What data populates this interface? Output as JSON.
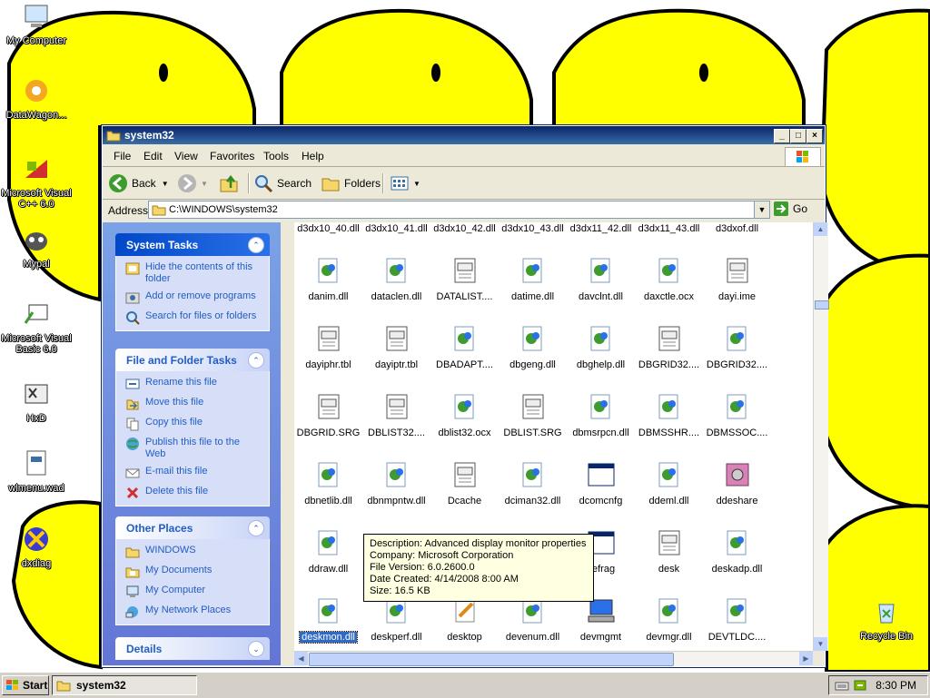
{
  "desktop": {
    "icons": [
      {
        "label": "My Computer",
        "icon": "my-computer-icon"
      },
      {
        "label": "DataWagon...",
        "icon": "datawagon-icon"
      },
      {
        "label": "Microsoft Visual C++ 6.0",
        "icon": "visual-cpp-icon"
      },
      {
        "label": "Mypal",
        "icon": "mypal-icon"
      },
      {
        "label": "Microsoft Visual Basic 6.0",
        "icon": "visual-basic-icon"
      },
      {
        "label": "HxD",
        "icon": "hxd-icon"
      },
      {
        "label": "wlmenu.wad",
        "icon": "wad-file-icon"
      },
      {
        "label": "dxdiag",
        "icon": "dxdiag-icon"
      },
      {
        "label": "Recycle Bin",
        "icon": "recycle-bin-icon"
      }
    ]
  },
  "window": {
    "title": "system32",
    "menu": [
      "File",
      "Edit",
      "View",
      "Favorites",
      "Tools",
      "Help"
    ],
    "toolbar": {
      "back": "Back",
      "search": "Search",
      "folders": "Folders"
    },
    "address": {
      "label": "Address",
      "path": "C:\\WINDOWS\\system32",
      "go": "Go"
    }
  },
  "taskpane": {
    "system_tasks": {
      "title": "System Tasks",
      "items": [
        "Hide the contents of this folder",
        "Add or remove programs",
        "Search for files or folders"
      ]
    },
    "file_tasks": {
      "title": "File and Folder Tasks",
      "items": [
        "Rename this file",
        "Move this file",
        "Copy this file",
        "Publish this file to the Web",
        "E-mail this file",
        "Delete this file"
      ]
    },
    "other_places": {
      "title": "Other Places",
      "items": [
        "WINDOWS",
        "My Documents",
        "My Computer",
        "My Network Places"
      ]
    },
    "details": {
      "title": "Details"
    }
  },
  "files": {
    "rows": [
      [
        {
          "name": "d3dx10_40.dll",
          "type": "dll"
        },
        {
          "name": "d3dx10_41.dll",
          "type": "dll"
        },
        {
          "name": "d3dx10_42.dll",
          "type": "dll"
        },
        {
          "name": "d3dx10_43.dll",
          "type": "dll"
        },
        {
          "name": "d3dx11_42.dll",
          "type": "dll"
        },
        {
          "name": "d3dx11_43.dll",
          "type": "dll"
        },
        {
          "name": "d3dxof.dll",
          "type": "dll"
        }
      ],
      [
        {
          "name": "danim.dll",
          "type": "dll"
        },
        {
          "name": "dataclen.dll",
          "type": "dll"
        },
        {
          "name": "DATALIST....",
          "type": "doc"
        },
        {
          "name": "datime.dll",
          "type": "dll"
        },
        {
          "name": "davclnt.dll",
          "type": "dll"
        },
        {
          "name": "daxctle.ocx",
          "type": "dll"
        },
        {
          "name": "dayi.ime",
          "type": "doc"
        }
      ],
      [
        {
          "name": "dayiphr.tbl",
          "type": "doc"
        },
        {
          "name": "dayiptr.tbl",
          "type": "doc"
        },
        {
          "name": "DBADAPT....",
          "type": "dll"
        },
        {
          "name": "dbgeng.dll",
          "type": "dll"
        },
        {
          "name": "dbghelp.dll",
          "type": "dll"
        },
        {
          "name": "DBGRID32....",
          "type": "doc"
        },
        {
          "name": "DBGRID32....",
          "type": "dll"
        }
      ],
      [
        {
          "name": "DBGRID.SRG",
          "type": "doc"
        },
        {
          "name": "DBLIST32....",
          "type": "doc"
        },
        {
          "name": "dblist32.ocx",
          "type": "dll"
        },
        {
          "name": "DBLIST.SRG",
          "type": "doc"
        },
        {
          "name": "dbmsrpcn.dll",
          "type": "dll"
        },
        {
          "name": "DBMSSHR....",
          "type": "dll"
        },
        {
          "name": "DBMSSOC....",
          "type": "dll"
        }
      ],
      [
        {
          "name": "dbnetlib.dll",
          "type": "dll"
        },
        {
          "name": "dbnmpntw.dll",
          "type": "dll"
        },
        {
          "name": "Dcache",
          "type": "doc"
        },
        {
          "name": "dciman32.dll",
          "type": "dll"
        },
        {
          "name": "dcomcnfg",
          "type": "window"
        },
        {
          "name": "ddeml.dll",
          "type": "dll"
        },
        {
          "name": "ddeshare",
          "type": "safe"
        }
      ],
      [
        {
          "name": "ddraw.dll",
          "type": "dll"
        },
        {
          "name": "",
          "type": "hidden"
        },
        {
          "name": "",
          "type": "hidden"
        },
        {
          "name": "",
          "type": "hidden"
        },
        {
          "name": "defrag",
          "type": "window"
        },
        {
          "name": "desk",
          "type": "doc"
        },
        {
          "name": "deskadp.dll",
          "type": "dll"
        }
      ],
      [
        {
          "name": "deskmon.dll",
          "type": "dll",
          "selected": true
        },
        {
          "name": "deskperf.dll",
          "type": "dll"
        },
        {
          "name": "desktop",
          "type": "pen"
        },
        {
          "name": "devenum.dll",
          "type": "dll"
        },
        {
          "name": "devmgmt",
          "type": "computer"
        },
        {
          "name": "devmgr.dll",
          "type": "dll"
        },
        {
          "name": "DEVTLDC....",
          "type": "dll"
        }
      ]
    ]
  },
  "tooltip": {
    "description": "Description: Advanced display monitor properties",
    "company": "Company: Microsoft Corporation",
    "version": "File Version: 6.0.2600.0",
    "created": "Date Created: 4/14/2008 8:00 AM",
    "size": "Size: 16.5 KB"
  },
  "taskbar": {
    "start": "Start",
    "task": "system32",
    "clock": "8:30 PM"
  },
  "colors": {
    "wallpaper": "#ffffff",
    "smiley": "#ffff00",
    "titlebar": "#0a246a",
    "taskpane": "#6375d6",
    "link": "#215dc6"
  }
}
